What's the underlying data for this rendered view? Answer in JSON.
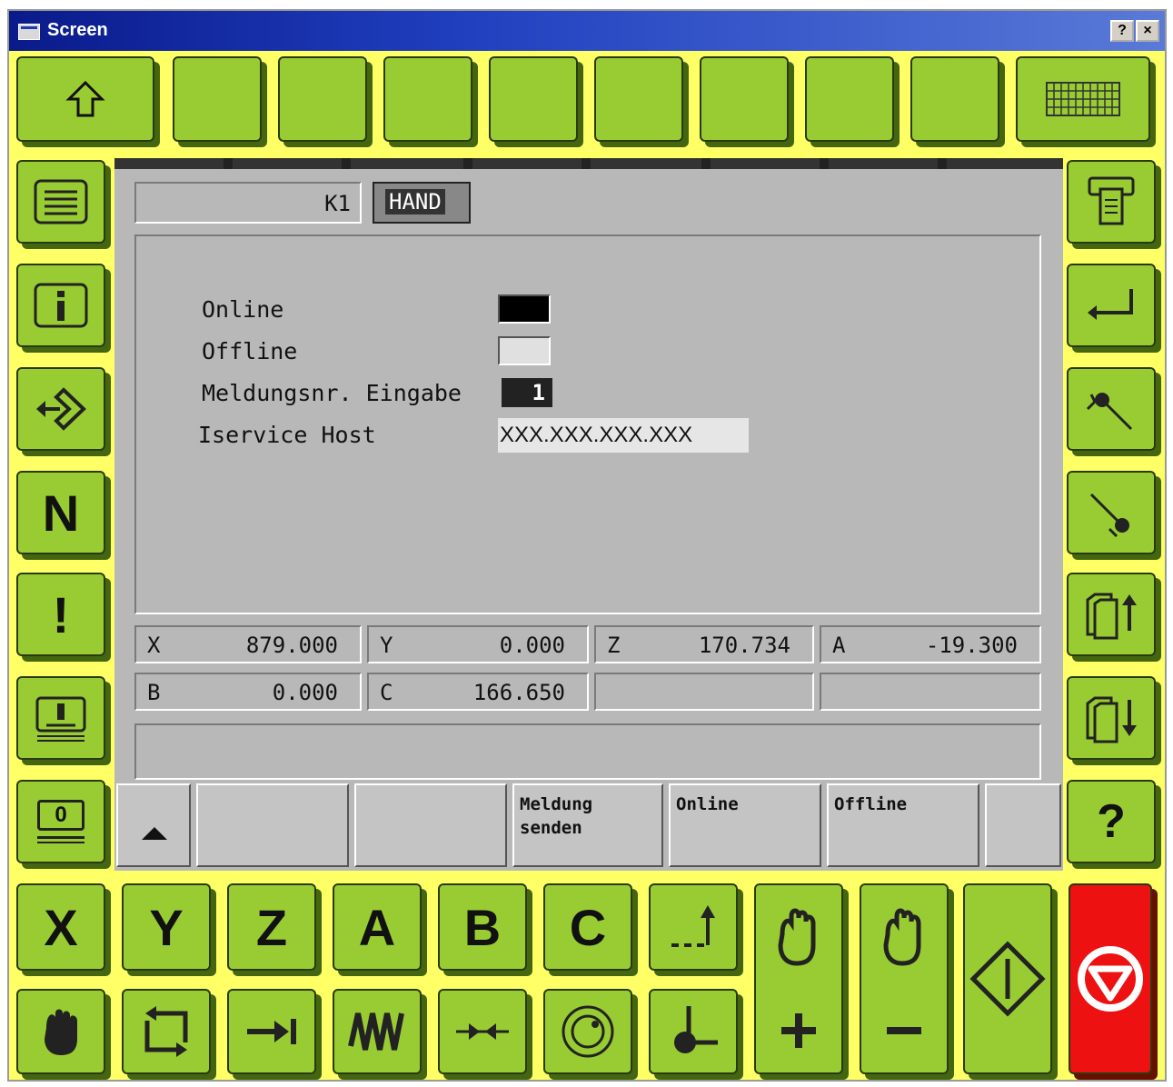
{
  "window": {
    "title": "Screen",
    "help_btn": "?",
    "close_btn": "×"
  },
  "status": {
    "k1": "K1",
    "mode": "HAND"
  },
  "main": {
    "online_label": "Online",
    "offline_label": "Offline",
    "msg_label": "Meldungsnr. Eingabe",
    "msg_value": "1",
    "host_label": "Iservice Host",
    "host_value": "XXX.XXX.XXX.XXX"
  },
  "axes": {
    "x": {
      "name": "X",
      "value": "879.000"
    },
    "y": {
      "name": "Y",
      "value": "0.000"
    },
    "z": {
      "name": "Z",
      "value": "170.734"
    },
    "a": {
      "name": "A",
      "value": "-19.300"
    },
    "b": {
      "name": "B",
      "value": "0.000"
    },
    "c": {
      "name": "C",
      "value": "166.650"
    }
  },
  "softkeys": {
    "send_message": "Meldung\nsenden",
    "online": "Online",
    "offline": "Offline"
  },
  "left_keys": {
    "n": "N",
    "excl": "!",
    "zero": "0"
  },
  "right_keys": {
    "help": "?"
  },
  "axis_keys": {
    "x": "X",
    "y": "Y",
    "z": "Z",
    "a": "A",
    "b": "B",
    "c": "C"
  },
  "colors": {
    "key_green": "#99cc33",
    "frame_yellow": "#ffff66",
    "stop_red": "#ee1111",
    "panel_grey": "#b8b8b8"
  }
}
